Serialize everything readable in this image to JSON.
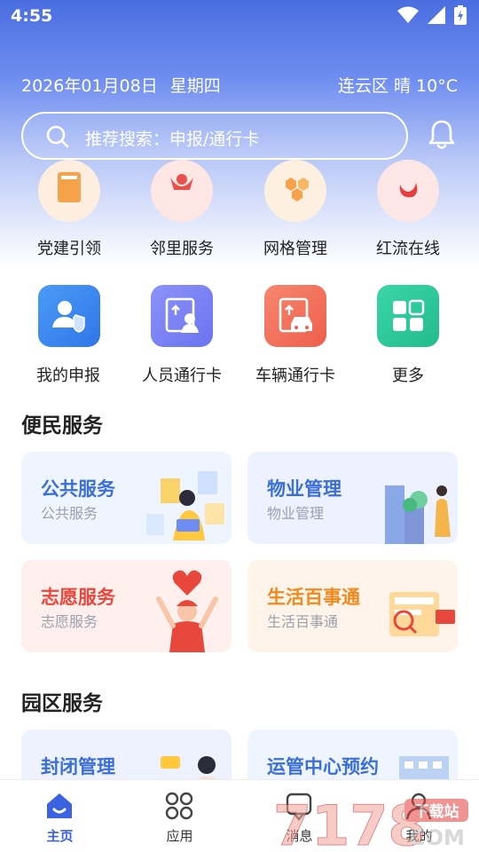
{
  "status_bar": {
    "time": "4:55"
  },
  "header": {
    "date": "2026年01月08日",
    "weekday": "星期四",
    "weather": "连云区 晴 10°C"
  },
  "search": {
    "placeholder": "推荐搜索：申报/通行卡"
  },
  "top_services": [
    {
      "label": "党建引领",
      "icon": "book-icon"
    },
    {
      "label": "邻里服务",
      "icon": "helping-hands-icon"
    },
    {
      "label": "网格管理",
      "icon": "hexagon-grid-icon"
    },
    {
      "label": "红流在线",
      "icon": "red-flag-swirl-icon"
    }
  ],
  "quick_actions": [
    {
      "label": "我的申报",
      "icon": "user-shield-icon",
      "color": "#3d8bf2"
    },
    {
      "label": "人员通行卡",
      "icon": "person-pass-icon",
      "color": "#7a84f5"
    },
    {
      "label": "车辆通行卡",
      "icon": "car-pass-icon",
      "color": "#f2735e"
    },
    {
      "label": "更多",
      "icon": "grid-more-icon",
      "color": "#2fc99b"
    }
  ],
  "sections": {
    "convenience": {
      "title": "便民服务",
      "cards": [
        {
          "title": "公共服务",
          "subtitle": "公共服务",
          "accent": "#3b6fd8",
          "bg": "#eef5ff"
        },
        {
          "title": "物业管理",
          "subtitle": "物业管理",
          "accent": "#3b6fd8",
          "bg": "#eef1ff"
        },
        {
          "title": "志愿服务",
          "subtitle": "志愿服务",
          "accent": "#e8473c",
          "bg": "#fff0ee"
        },
        {
          "title": "生活百事通",
          "subtitle": "生活百事通",
          "accent": "#f08a1e",
          "bg": "#fff4ea"
        }
      ]
    },
    "park": {
      "title": "园区服务",
      "cards": [
        {
          "title": "封闭管理",
          "accent": "#3b6fd8",
          "bg": "#eef2ff"
        },
        {
          "title": "运管中心预约",
          "accent": "#3b6fd8",
          "bg": "#eef5ff"
        }
      ]
    }
  },
  "bottom_nav": [
    {
      "label": "主页",
      "icon": "home-icon",
      "active": true
    },
    {
      "label": "应用",
      "icon": "apps-icon",
      "active": false
    },
    {
      "label": "消息",
      "icon": "message-icon",
      "active": false
    },
    {
      "label": "我的",
      "icon": "profile-icon",
      "active": false
    }
  ],
  "watermark": {
    "text": "7178",
    "tag": "下载站",
    "suffix": "COM"
  }
}
